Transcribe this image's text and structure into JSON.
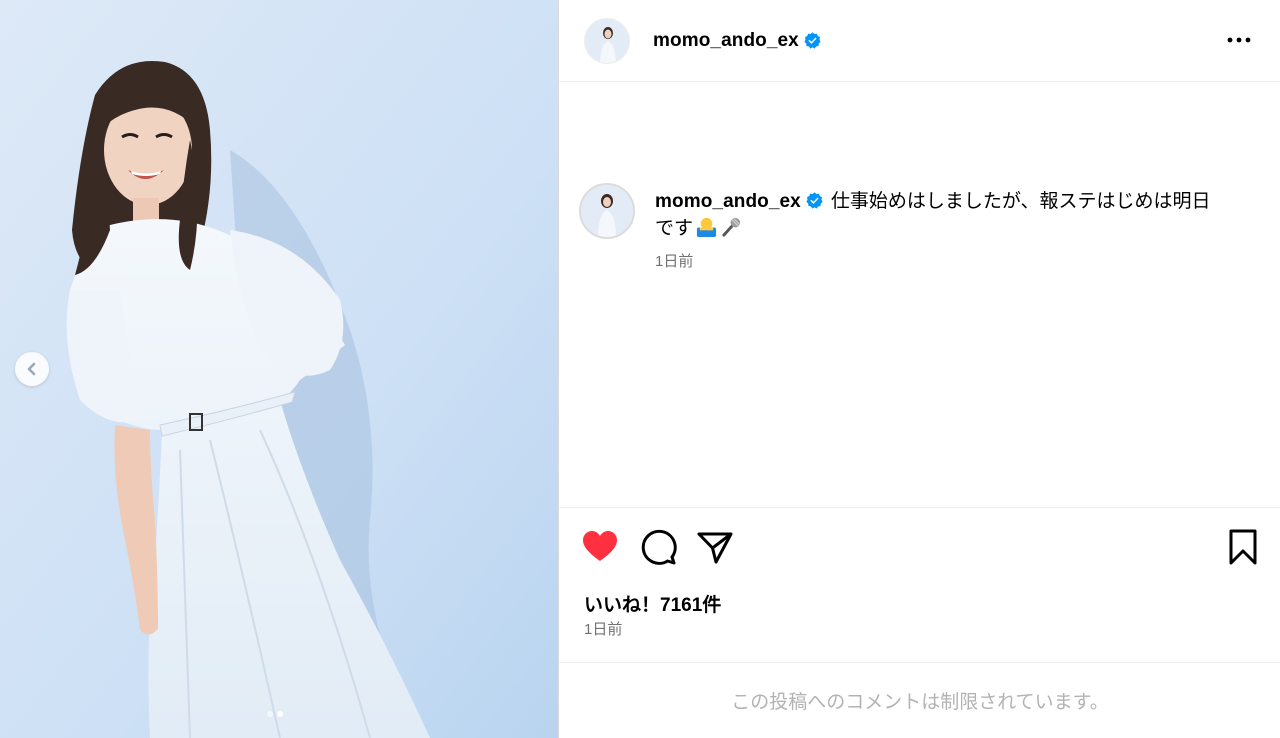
{
  "post": {
    "username": "momo_ando_ex",
    "verified": true,
    "caption_line1": "仕事始めはしましたが、報ステはじめは明日",
    "caption_line2": "です",
    "caption_emojis": [
      "person-raising-hand-emoji",
      "microphone-emoji"
    ],
    "caption_time": "1日前",
    "likes": "いいね！7161件",
    "post_time": "1日前",
    "comments_limited": "この投稿へのコメントは制限されています。",
    "liked": true
  },
  "carousel": {
    "total": 2,
    "current": 2
  },
  "colors": {
    "like_red": "#ff3040",
    "verified_blue": "#0095f6",
    "secondary_text": "#737373"
  },
  "icons": {
    "more": "more-options-icon",
    "like": "heart-filled-icon",
    "comment": "comment-icon",
    "share": "share-icon",
    "save": "bookmark-icon",
    "prev": "chevron-left-icon"
  }
}
